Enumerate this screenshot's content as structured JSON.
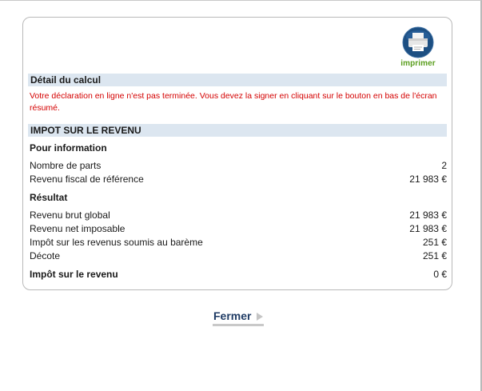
{
  "print": {
    "label": "imprimer",
    "icon": "printer-icon"
  },
  "detail": {
    "title": "Détail du calcul",
    "warning": "Votre déclaration en ligne n'est pas terminée. Vous devez la signer en cliquant sur le bouton en bas de l'écran résumé."
  },
  "impot": {
    "title": "IMPOT SUR LE REVENU",
    "info_heading": "Pour information",
    "info_rows": [
      {
        "label": "Nombre de parts",
        "value": "2"
      },
      {
        "label": "Revenu fiscal de référence",
        "value": "21 983 €"
      }
    ],
    "result_heading": "Résultat",
    "result_rows": [
      {
        "label": "Revenu brut global",
        "value": "21 983 €"
      },
      {
        "label": "Revenu net imposable",
        "value": "21 983 €"
      },
      {
        "label": "Impôt sur les revenus soumis au barème",
        "value": "251 €"
      },
      {
        "label": "Décote",
        "value": "251 €"
      }
    ],
    "total": {
      "label": "Impôt sur le revenu",
      "value": "0 €"
    }
  },
  "close": {
    "label": "Fermer"
  },
  "colors": {
    "warning": "#d40000",
    "section_bg": "#dce6f0",
    "print_green": "#5a9e1e",
    "link_blue": "#1f3b64"
  }
}
